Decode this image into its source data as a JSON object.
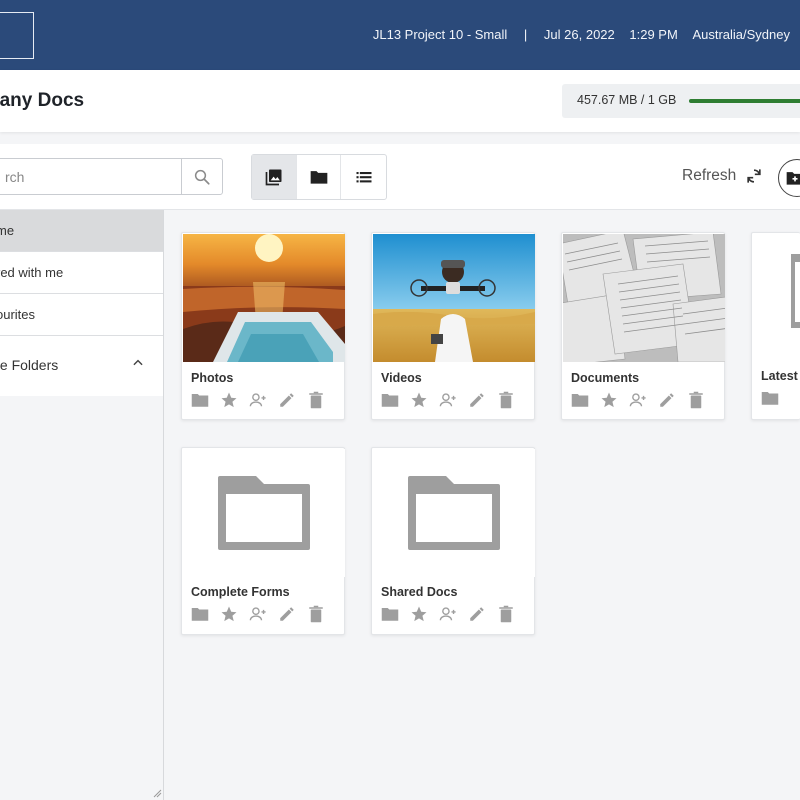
{
  "header": {
    "project": "JL13 Project 10 - Small",
    "separator": "|",
    "date": "Jul 26, 2022",
    "time": "1:29 PM",
    "timezone": "Australia/Sydney"
  },
  "page": {
    "title": "pany Docs",
    "storage": {
      "text": "457.67 MB / 1 GB",
      "used_fraction": 0.4577,
      "bar_color": "#2e7d32"
    }
  },
  "toolbar": {
    "search_placeholder": "rch",
    "views": [
      {
        "icon": "gallery-view-icon",
        "active": true
      },
      {
        "icon": "folder-view-icon",
        "active": false
      },
      {
        "icon": "list-view-icon",
        "active": false
      }
    ],
    "refresh_label": "Refresh"
  },
  "sidebar": {
    "items": [
      {
        "label": "me",
        "active": true
      },
      {
        "label": "red with me",
        "active": false
      },
      {
        "label": "ourites",
        "active": false
      }
    ],
    "section_label": "te Folders"
  },
  "folders": [
    {
      "name": "Photos",
      "thumb": "photo"
    },
    {
      "name": "Videos",
      "thumb": "photo"
    },
    {
      "name": "Documents",
      "thumb": "photo"
    },
    {
      "name": "Latest",
      "thumb": "folder"
    },
    {
      "name": "Complete Forms",
      "thumb": "folder"
    },
    {
      "name": "Shared Docs",
      "thumb": "folder"
    }
  ],
  "colors": {
    "header_bg": "#2b4a7a",
    "icon_gray": "#9e9e9e"
  }
}
